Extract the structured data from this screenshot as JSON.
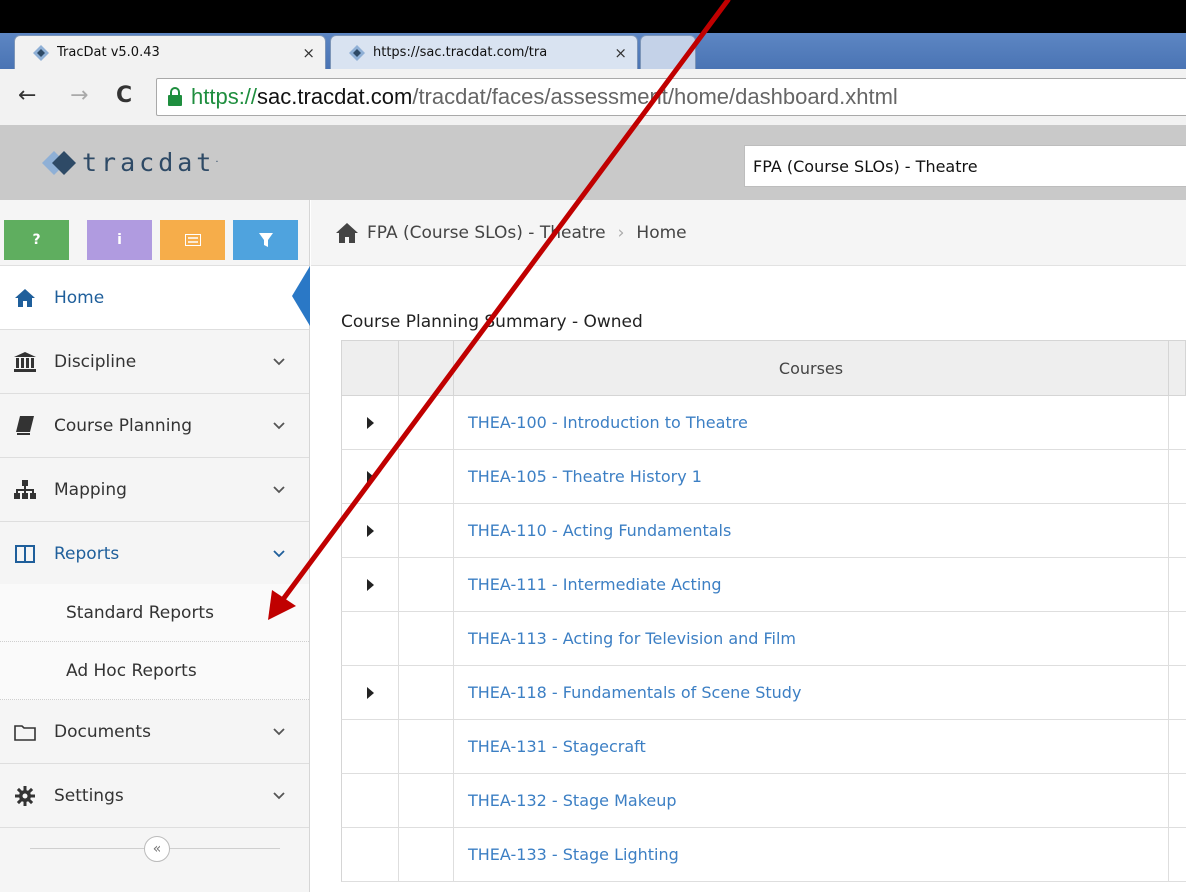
{
  "browser": {
    "tabs": [
      {
        "title": "TracDat v5.0.43",
        "close": "×"
      },
      {
        "title": "https://sac.tracdat.com/tra",
        "close": "×"
      }
    ],
    "back": "←",
    "forward": "→",
    "reload": "C",
    "url_protocol": "https://",
    "url_host": "sac.tracdat.com",
    "url_path": "/tracdat/faces/assessment/home/dashboard.xhtml"
  },
  "app": {
    "logo_text": "tracdat",
    "logo_mark": "·",
    "context_selector": "FPA (Course SLOs) - Theatre"
  },
  "toolbar": {
    "help": "?",
    "info": "i"
  },
  "sidebar": {
    "items": [
      {
        "label": "Home",
        "icon": "home-icon"
      },
      {
        "label": "Discipline",
        "icon": "institution-icon"
      },
      {
        "label": "Course Planning",
        "icon": "book-icon"
      },
      {
        "label": "Mapping",
        "icon": "sitemap-icon"
      },
      {
        "label": "Reports",
        "icon": "columns-icon"
      },
      {
        "label": "Documents",
        "icon": "folder-icon"
      },
      {
        "label": "Settings",
        "icon": "gear-icon"
      }
    ],
    "sub_items": [
      {
        "label": "Standard Reports"
      },
      {
        "label": "Ad Hoc Reports"
      }
    ],
    "collapse": "«"
  },
  "breadcrumb": {
    "context": "FPA (Course SLOs) - Theatre",
    "separator": "›",
    "current": "Home"
  },
  "main": {
    "section_title": "Course Planning Summary - Owned",
    "table": {
      "column_header": "Courses",
      "rows": [
        {
          "course": "THEA-100 - Introduction to Theatre",
          "expandable": true
        },
        {
          "course": "THEA-105 - Theatre History 1",
          "expandable": true
        },
        {
          "course": "THEA-110 - Acting Fundamentals",
          "expandable": true
        },
        {
          "course": "THEA-111 - Intermediate Acting",
          "expandable": true
        },
        {
          "course": "THEA-113 - Acting for Television and Film",
          "expandable": false
        },
        {
          "course": "THEA-118 - Fundamentals of Scene Study",
          "expandable": true
        },
        {
          "course": "THEA-131 - Stagecraft",
          "expandable": false
        },
        {
          "course": "THEA-132 - Stage Makeup",
          "expandable": false
        },
        {
          "course": "THEA-133 - Stage Lighting",
          "expandable": false
        }
      ]
    }
  },
  "colors": {
    "accent_blue": "#2a78c6",
    "link_blue": "#3c7fc4",
    "annotation_red": "#c00000",
    "help_green": "#5fae5f",
    "info_purple": "#b09be0",
    "notes_orange": "#f6ad4a",
    "filter_blue": "#4fa3de"
  }
}
